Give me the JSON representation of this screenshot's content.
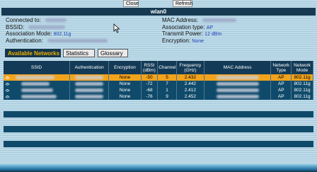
{
  "buttons": {
    "close": "Close",
    "refresh": "Refresh"
  },
  "title": "wlan0",
  "info": {
    "connected_to_label": "Connected to:",
    "bssid_label": "BSSID:",
    "assoc_mode_label": "Association Mode:",
    "assoc_mode_value": "802.11g",
    "auth_label": "Authentication:",
    "mac_label": "MAC Address:",
    "assoc_type_label": "Association type:",
    "assoc_type_value": "AP",
    "tx_power_label": "Transmit Power:",
    "tx_power_value": "12 dBm",
    "encryption_label": "Encryption:",
    "encryption_value": "None"
  },
  "tabs": [
    "Available Networks",
    "Statistics",
    "Glossary"
  ],
  "table": {
    "headers": [
      "SSID",
      "Authentication",
      "Encryption",
      "RSSI (dBm)",
      "Channel",
      "Frequency (GHz)",
      "MAC Address",
      "Network Type",
      "Network Mode"
    ],
    "rows": [
      {
        "selected": true,
        "encryption": "None",
        "rssi": "-50",
        "channel": "5",
        "frequency": "2.432",
        "type": "AP",
        "mode": "802.11g"
      },
      {
        "selected": false,
        "encryption": "None",
        "rssi": "-72",
        "channel": "7",
        "frequency": "2.442",
        "type": "AP",
        "mode": "802.11g"
      },
      {
        "selected": false,
        "encryption": "None",
        "rssi": "-68",
        "channel": "1",
        "frequency": "2.412",
        "type": "AP",
        "mode": "802.11g"
      },
      {
        "selected": false,
        "encryption": "None",
        "rssi": "-76",
        "channel": "9",
        "frequency": "2.452",
        "type": "AP",
        "mode": "802.11g"
      }
    ]
  },
  "colors": {
    "accent": "#f2a31c",
    "header": "#133a56",
    "row": "#0f4a6a",
    "value_text": "#1b3fb5"
  },
  "icons": {
    "network": "wifi-network-icon",
    "cursor": "mouse-pointer-icon"
  }
}
